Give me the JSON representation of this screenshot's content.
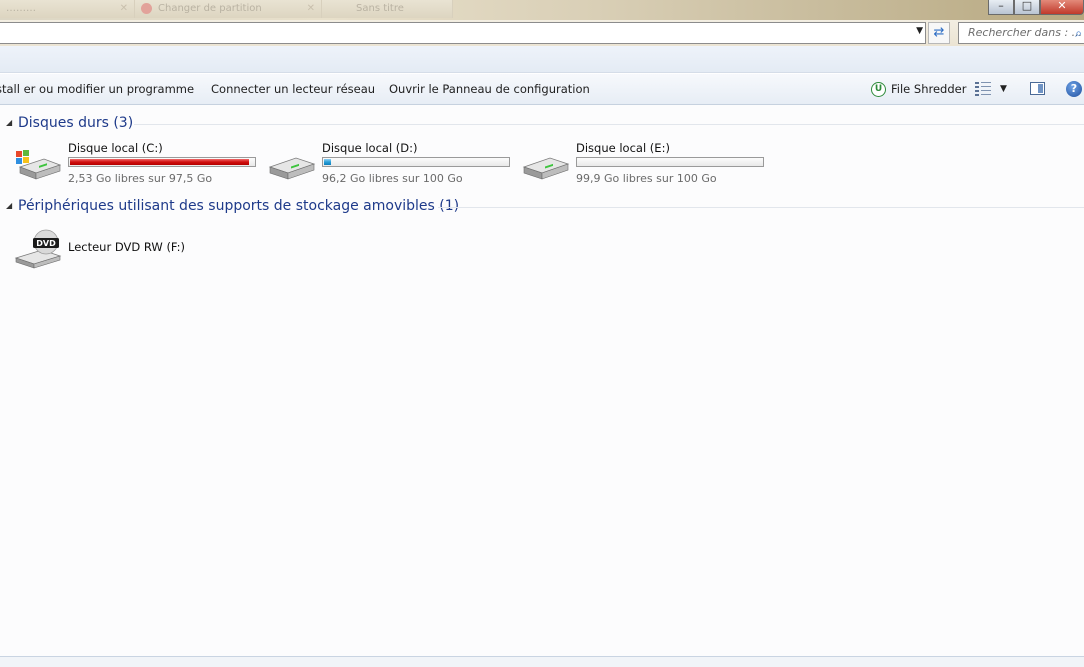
{
  "tabs": [
    {
      "label": "………"
    },
    {
      "label": "Changer de partition"
    },
    {
      "label": "Sans titre"
    }
  ],
  "window_controls": {
    "minimize": "–",
    "maximize": "□",
    "close": "✕"
  },
  "address": {
    "dropdown_glyph": "▼",
    "refresh_glyph": "⇄"
  },
  "search": {
    "placeholder": "Rechercher dans : ...",
    "icon": "search-icon",
    "glyph": "⌕"
  },
  "commands": {
    "install_program": "stall er ou modifier un programme",
    "map_network_drive": "Connecter un lecteur réseau",
    "open_control_panel": "Ouvrir le Panneau de configuration",
    "file_shredder": "File Shredder",
    "file_shredder_badge": "U",
    "views_dropdown": "▼",
    "help": "?"
  },
  "groups": {
    "hard_disks": {
      "title": "Disques durs (3)",
      "toggle": "◢"
    },
    "removable": {
      "title": "Périphériques utilisant des supports de stockage amovibles (1)",
      "toggle": "◢"
    }
  },
  "drives": [
    {
      "name": "Disque local (C:)",
      "free_text": "2,53 Go libres sur 97,5 Go",
      "used_fraction": 0.974,
      "bar_color": "#d10f0f",
      "icon": "windows-drive-icon"
    },
    {
      "name": "Disque local (D:)",
      "free_text": "96,2 Go libres sur 100 Go",
      "used_fraction": 0.038,
      "bar_color": "#2a9fd8",
      "icon": "hard-drive-icon"
    },
    {
      "name": "Disque local (E:)",
      "free_text": "99,9 Go libres sur 100 Go",
      "used_fraction": 0.001,
      "bar_color": "#2a9fd8",
      "icon": "hard-drive-icon"
    }
  ],
  "removable_devices": [
    {
      "name": "Lecteur DVD RW (F:)",
      "icon": "dvd-drive-icon",
      "icon_label": "DVD"
    }
  ],
  "colors": {
    "group_title": "#1e3a8a",
    "full_bar": "#d10f0f",
    "normal_bar": "#2a9fd8"
  }
}
